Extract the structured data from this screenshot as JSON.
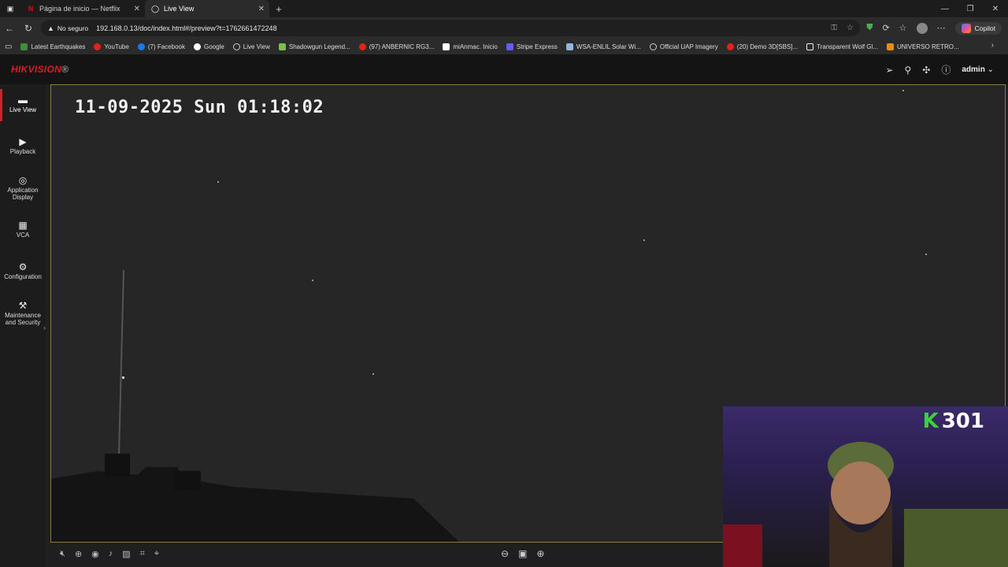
{
  "browser": {
    "tabs": [
      {
        "label": "Página de inicio — Netflix",
        "active": false
      },
      {
        "label": "Live View",
        "active": true
      }
    ],
    "address": {
      "security": "No seguro",
      "url": "192.168.0.13/doc/index.html#/preview?t=1762661472248"
    },
    "copilot_label": "Copilot",
    "bookmarks": [
      {
        "label": "Latest Earthquakes",
        "color": "#3c8f3c"
      },
      {
        "label": "YouTube",
        "color": "#e62117"
      },
      {
        "label": "(7) Facebook",
        "color": "#1877f2"
      },
      {
        "label": "Google",
        "color": "#ffffff"
      },
      {
        "label": "Live View",
        "color": "#cccccc"
      },
      {
        "label": "Shadowgun Legend...",
        "color": "#7ac142"
      },
      {
        "label": "(97) ANBERNIC RG3...",
        "color": "#e62117"
      },
      {
        "label": "miAnmac. Inicio",
        "color": "#ffffff"
      },
      {
        "label": "Stripe Express",
        "color": "#635bff"
      },
      {
        "label": "WSA-ENLIL Solar Wi...",
        "color": "#8fb7e0"
      },
      {
        "label": "Official UAP Imagery",
        "color": "#cccccc"
      },
      {
        "label": "(20) Demo 3D[SBS]...",
        "color": "#e62117"
      },
      {
        "label": "Transparent Wolf Gl...",
        "color": "#eeeeee"
      },
      {
        "label": "UNIVERSO RETRO...",
        "color": "#f08c00"
      }
    ]
  },
  "hik": {
    "logo_main": "HIKVISION",
    "logo_mark": "®",
    "user": "admin",
    "nav": [
      {
        "label": "Live View",
        "icon": "live-view-icon",
        "active": true
      },
      {
        "label": "Playback",
        "icon": "playback-icon",
        "active": false
      },
      {
        "label": "Application Display",
        "icon": "application-display-icon",
        "active": false
      },
      {
        "label": "VCA",
        "icon": "vca-icon",
        "active": false
      },
      {
        "label": "Configuration",
        "icon": "configuration-icon",
        "active": false
      },
      {
        "label": "Maintenance and Security",
        "icon": "maintenance-icon",
        "active": false
      }
    ]
  },
  "video": {
    "osd_timestamp": "11-09-2025 Sun 01:18:02"
  },
  "webcam": {
    "counter_prefix": "K",
    "counter_value": "301"
  }
}
